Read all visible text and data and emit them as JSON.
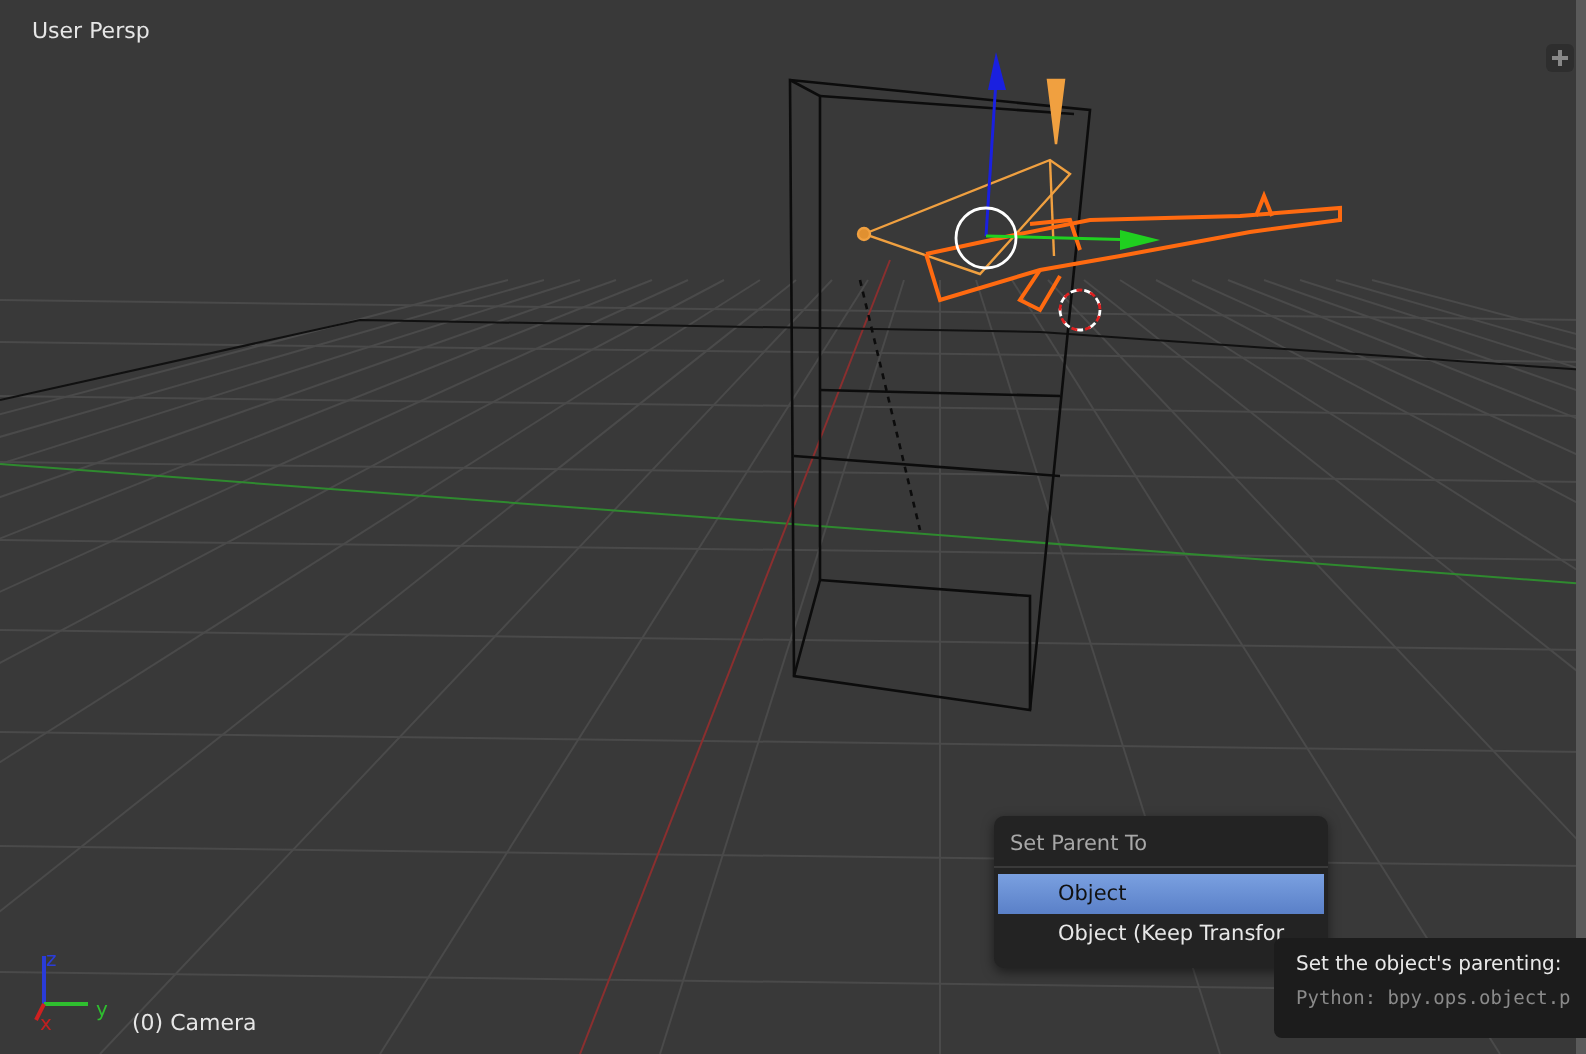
{
  "viewport": {
    "view_label": "User Persp",
    "object_label": "(0) Camera"
  },
  "axis_gizmo": {
    "labels": [
      {
        "kind": "z",
        "text": "z"
      },
      {
        "kind": "y",
        "text": "y"
      },
      {
        "kind": "x",
        "text": "x"
      }
    ]
  },
  "popup_menu": {
    "title": "Set Parent To",
    "items": [
      {
        "label": "Object",
        "selected": true
      },
      {
        "label": "Object (Keep Transfor",
        "selected": false
      }
    ]
  },
  "tooltip": {
    "description": "Set the object's parenting:",
    "python": "Python: bpy.ops.object.p"
  }
}
